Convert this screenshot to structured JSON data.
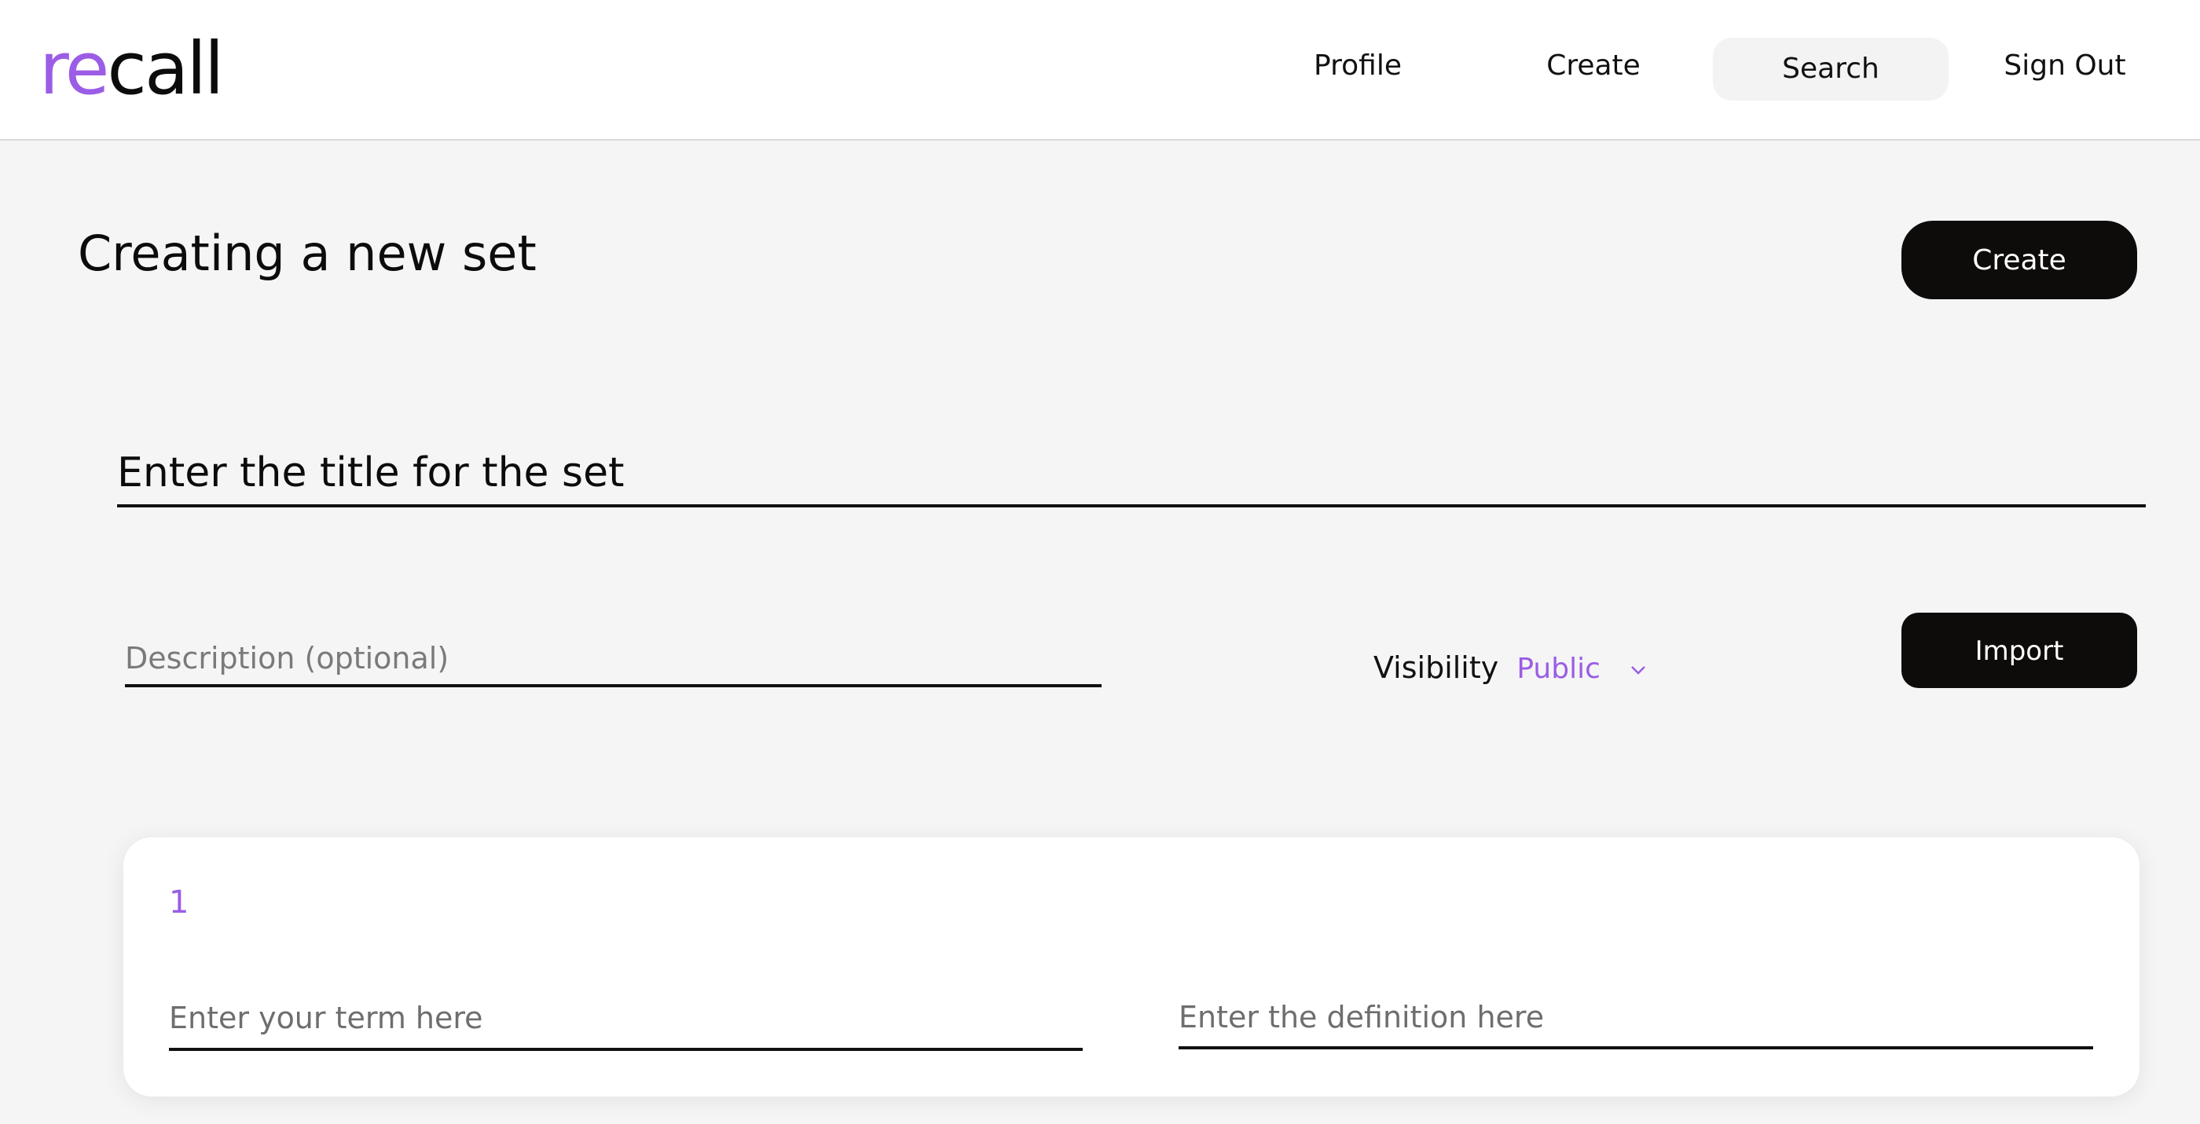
{
  "logo": {
    "accent": "re",
    "rest": "call"
  },
  "nav": {
    "profile": "Profile",
    "create": "Create",
    "search": "Search",
    "signout": "Sign Out"
  },
  "page": {
    "title": "Creating a new set",
    "create_button": "Create",
    "import_button": "Import"
  },
  "form": {
    "title_placeholder": "Enter the title for the set",
    "description_placeholder": "Description (optional)",
    "visibility_label": "Visibility",
    "visibility_value": "Public",
    "visibility_icon": "chevron-down-icon"
  },
  "cards": [
    {
      "number": "1",
      "term_placeholder": "Enter your term here",
      "definition_placeholder": "Enter the definition here"
    }
  ],
  "colors": {
    "accent": "#9b5de5",
    "dark_button": "#0d0c0a",
    "page_background": "#f5f5f5"
  }
}
